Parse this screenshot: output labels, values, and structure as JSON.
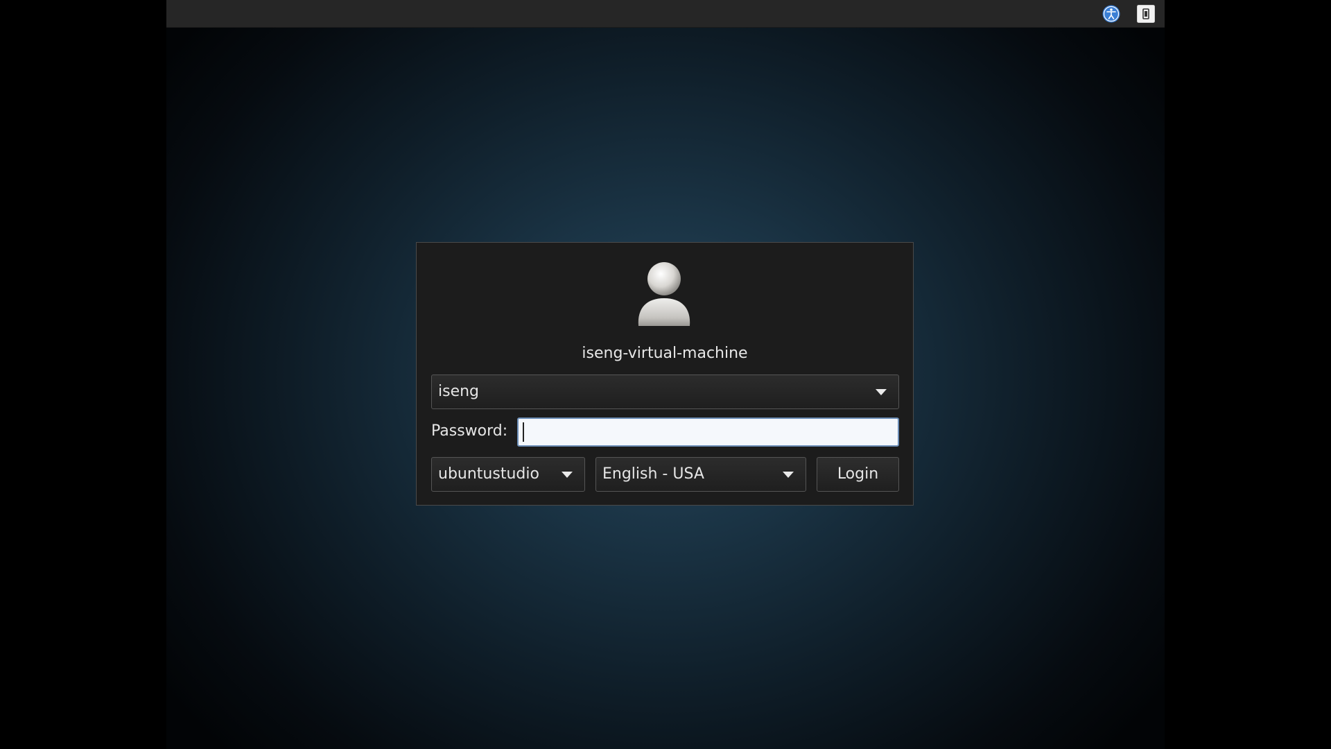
{
  "topbar": {
    "icons": [
      {
        "name": "accessibility-icon",
        "color": "#3a7fd5"
      },
      {
        "name": "power-icon",
        "color": "#f2f2f2"
      }
    ]
  },
  "login": {
    "avatar_icon": "user-avatar-icon",
    "hostname": "iseng-virtual-machine",
    "user": {
      "selected": "iseng"
    },
    "password": {
      "label": "Password:",
      "value": ""
    },
    "session": {
      "selected": "ubuntustudio"
    },
    "language": {
      "selected": "English - USA"
    },
    "login_button": "Login"
  },
  "colors": {
    "background_center": "#26465c",
    "background_edge": "#020406",
    "panel": "#1c1c1c",
    "input_focus_border": "#6d8fb8"
  }
}
